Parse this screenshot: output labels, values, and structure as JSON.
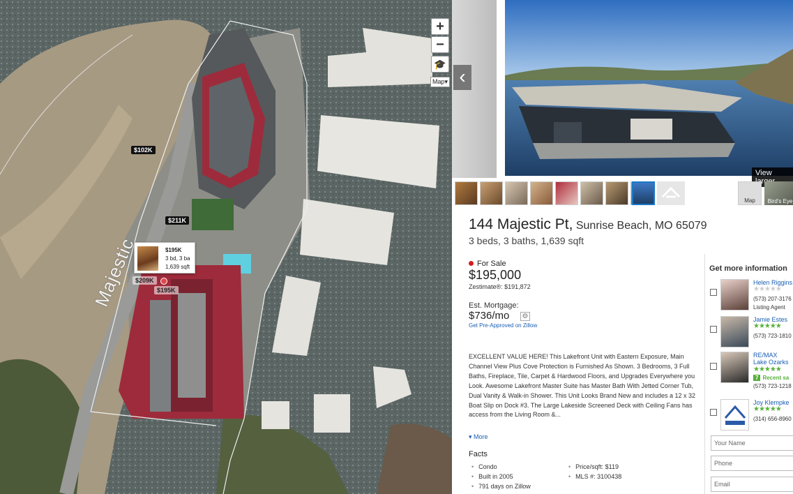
{
  "map": {
    "zoom_in": "+",
    "zoom_out": "−",
    "map_type": "Map▾",
    "road_label": "Majestic",
    "price_tags": [
      "$102K",
      "$211K",
      "$209K",
      "$195K"
    ],
    "popup": {
      "price": "$195K",
      "beds_baths": "3 bd, 3 ba",
      "sqft": "1,639 sqft"
    },
    "colors": {
      "water": "#55605f",
      "roof": "#9d2b3b",
      "accent_dot": "#e0484e"
    }
  },
  "gallery": {
    "prev_arrow": "‹",
    "view_larger": "View larger",
    "map_thumb_label": "Map",
    "bird_thumb_label": "Bird's Eye"
  },
  "listing": {
    "street": "144 Majestic Pt,",
    "city": "Sunrise Beach, MO 65079",
    "summary": "3 beds, 3 baths, 1,639 sqft",
    "status": "For Sale",
    "price": "$195,000",
    "zestimate": "Zestimate®: $191,872",
    "mortgage_label": "Est. Mortgage:",
    "mortgage_value": "$736/mo",
    "preapproved": "Get Pre-Approved on Zillow",
    "description": "EXCELLENT VALUE HERE! This Lakefront Unit with Eastern Exposure, Main Channel View Plus Cove Protection is Furnished As Shown. 3 Bedrooms, 3 Full Baths, Fireplace, Tile, Carpet & Hardwood Floors, and Upgrades Everywhere you Look. Awesome Lakefront Master Suite has Master Bath With Jetted Corner Tub, Dual Vanity & Walk-in Shower. This Unit Looks Brand New and includes a 12 x 32 Boat Slip on Dock #3. The Large Lakeside Screened Deck with Ceiling Fans has access from the Living Room &...",
    "more": "▾ More",
    "facts_title": "Facts",
    "facts_left": [
      "Condo",
      "Built in 2005",
      "791 days on Zillow"
    ],
    "facts_right": [
      "Price/sqft: $119",
      "MLS #: 3100438"
    ]
  },
  "agents": {
    "title": "Get more information",
    "list": [
      {
        "name": "Helen Riggins",
        "phone": "(573) 207-3176",
        "sub": "Listing Agent",
        "rating": 0
      },
      {
        "name": "Jamie Estes",
        "phone": "(573) 723-1810",
        "sub": "",
        "rating": 5
      },
      {
        "name": "RE/MAX Lake Ozarks",
        "phone": "(573) 723-1218",
        "sub": "",
        "rating": 5,
        "recent_count": "7",
        "recent_label": "Recent sa"
      },
      {
        "name": "Joy Klempke",
        "phone": "(314) 656-8960",
        "sub": "",
        "rating": 5
      }
    ],
    "placeholders": {
      "name": "Your Name",
      "phone": "Phone",
      "email": "Email"
    }
  }
}
